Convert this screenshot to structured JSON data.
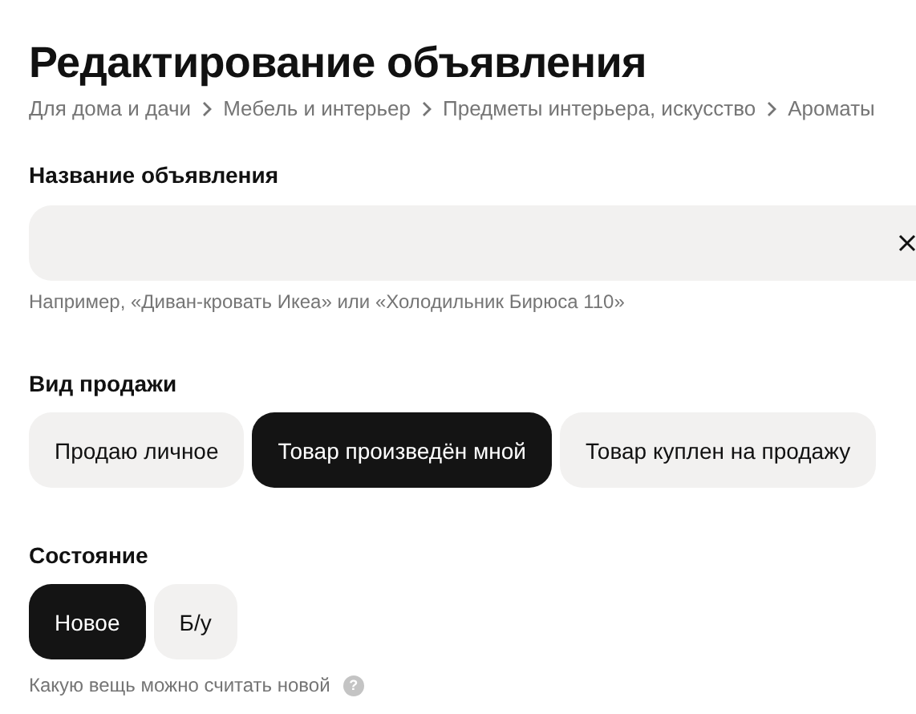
{
  "title": "Редактирование объявления",
  "breadcrumbs": [
    "Для дома и дачи",
    "Мебель и интерьер",
    "Предметы интерьера, искусство",
    "Ароматы"
  ],
  "name_field": {
    "label": "Название объявления",
    "hint": "Например, «Диван-кровать Икеа» или «Холодильник Бирюса 110»"
  },
  "sale_type": {
    "label": "Вид продажи",
    "options": [
      {
        "label": "Продаю личное",
        "selected": false
      },
      {
        "label": "Товар произведён мной",
        "selected": true
      },
      {
        "label": "Товар куплен на продажу",
        "selected": false
      }
    ]
  },
  "condition": {
    "label": "Состояние",
    "options": [
      {
        "label": "Новое",
        "selected": true
      },
      {
        "label": "Б/у",
        "selected": false
      }
    ],
    "help_link": "Какую вещь можно считать новой",
    "help_icon": "?"
  }
}
